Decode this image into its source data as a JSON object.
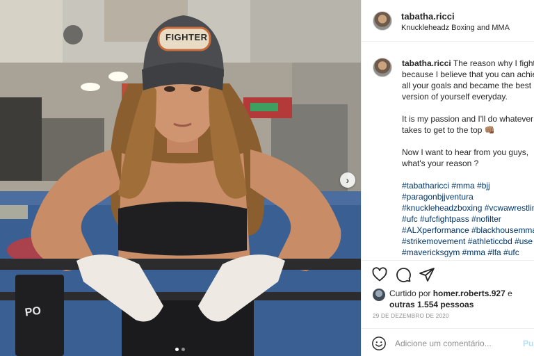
{
  "post": {
    "username": "tabatha.ricci",
    "location": "Knuckleheadz Boxing and MMA",
    "cap_badge_text": "FIGHTER",
    "wrap_strap_text": "PO"
  },
  "caption": {
    "username": "tabatha.ricci",
    "line1": "The reason why I fight",
    "line2": "because I believe that you can achie",
    "line3": "all your goals and became the best",
    "line4": "version of yourself everyday.",
    "line5": "It is my passion and I'll do whatever",
    "line6": "takes to get to the top 👊🏽",
    "line7": "Now I want to hear from you guys,",
    "line8": "what's your reason ?",
    "hashtags": [
      "#tabatharicci #mma #bjj",
      "#paragonbjjventura",
      "#knuckleheadzboxing #vcwawrestlin",
      "#ufc #ufcfightpass #nofilter",
      "#ALXperformance #blackhousemma",
      "#strikemovement #athleticcbd #use",
      "#mavericksgym #mma #lfa #ufc",
      "#..."
    ]
  },
  "actions": {
    "like_icon": "heart-icon",
    "comment_icon": "comment-icon",
    "share_icon": "share-icon"
  },
  "likes": {
    "prefix": "Curtido por ",
    "user": "homer.roberts.927",
    "middle": " e",
    "others": "outras 1.554 pessoas"
  },
  "date": "29 DE DEZEMBRO DE 2020",
  "comment": {
    "placeholder": "Adicione um comentário...",
    "post_label": "Publicar"
  },
  "carousel": {
    "next_icon": "chevron-right-icon",
    "slide_count": 2,
    "active_slide": 1
  }
}
